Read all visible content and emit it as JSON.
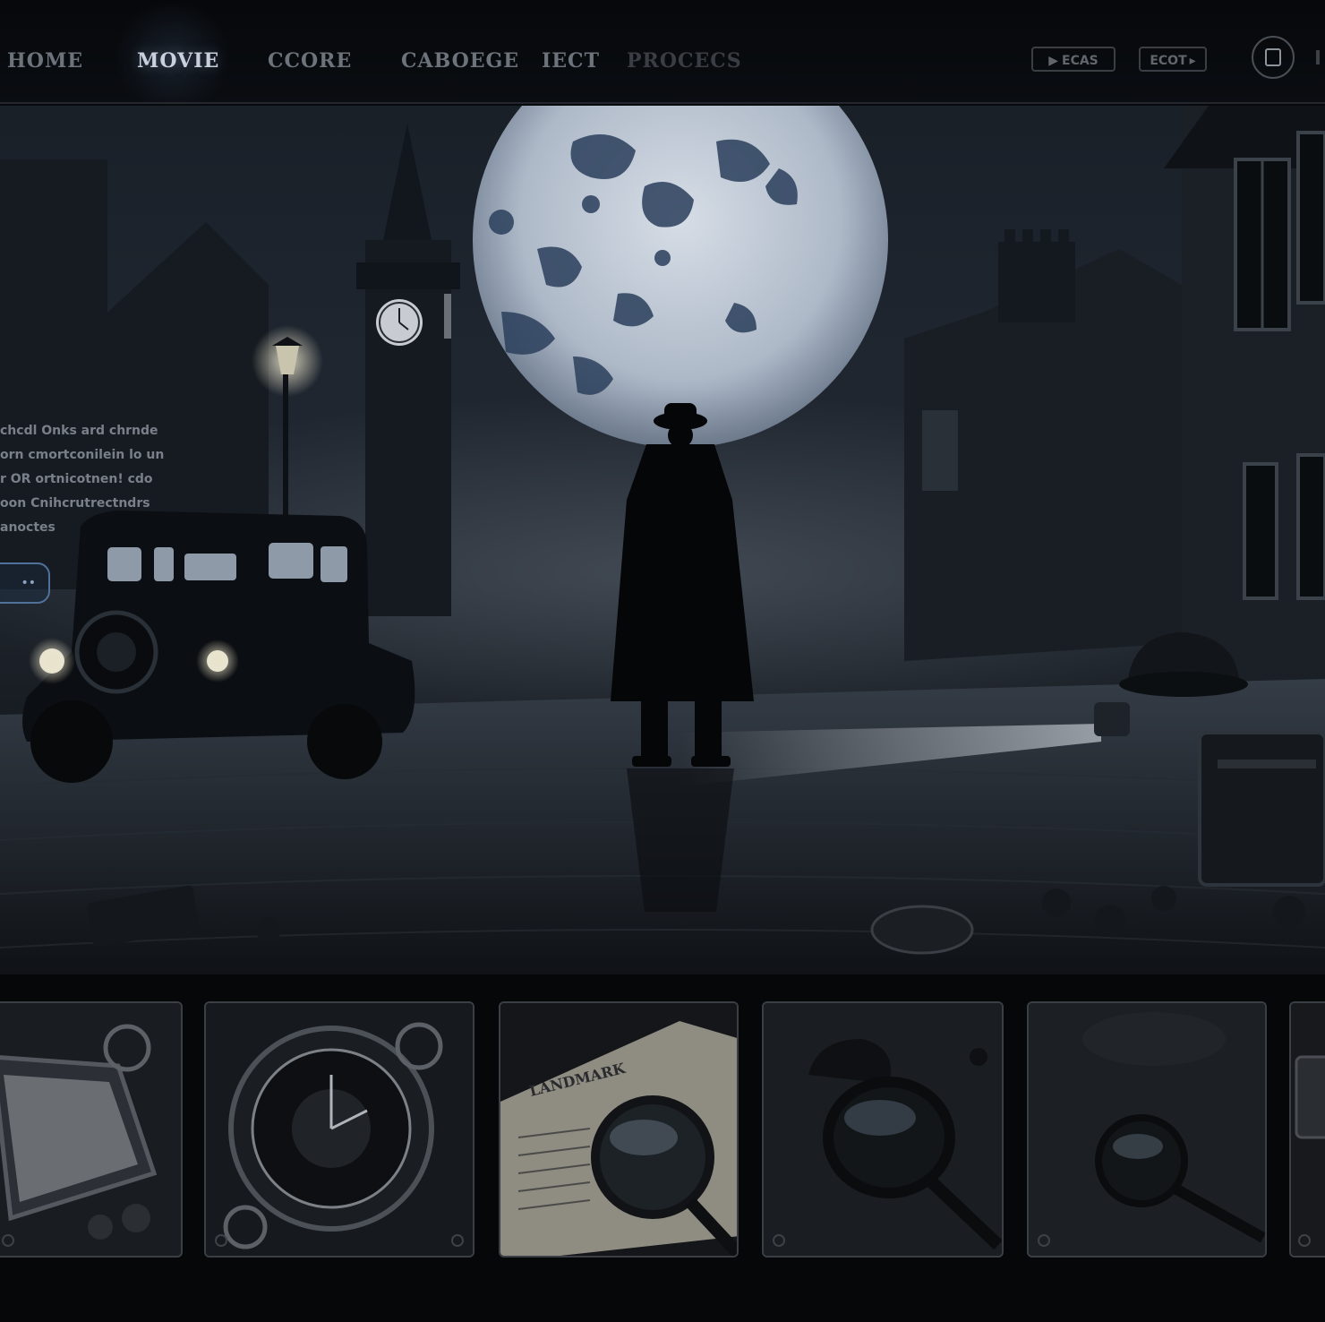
{
  "nav": {
    "items": [
      {
        "label": "HOME",
        "active": false
      },
      {
        "label": "MOVIE",
        "active": true
      },
      {
        "label": "CCORE",
        "active": false
      },
      {
        "label": "CABOEGE",
        "active": false
      },
      {
        "label": "IECT",
        "active": false
      },
      {
        "label": "PROCECS",
        "active": false
      }
    ],
    "chips": [
      {
        "label": "ECAS",
        "icon": "play-circle-icon"
      },
      {
        "label": "ECOT",
        "icon": "bookmark-icon"
      }
    ],
    "profile_icon": "account-square-icon"
  },
  "hero": {
    "description_lines": [
      "chcdl Onks ard chrnde",
      "orn cmortconilein lo un",
      "r OR  ortnicotnen! cdo",
      "oon Cnihcrutrectndrs",
      "anoctes"
    ],
    "cta_label": "••",
    "scene": "detective-night-scene"
  },
  "thumbnails": [
    {
      "subject": "framed-map-thumbnail"
    },
    {
      "subject": "pocket-watch-thumbnail"
    },
    {
      "subject": "newspaper-magnifier-thumbnail",
      "caption": "LANDMARK"
    },
    {
      "subject": "magnifier-hat-thumbnail"
    },
    {
      "subject": "magnifier-thumbnail"
    },
    {
      "subject": "partial-thumbnail"
    }
  ],
  "colors": {
    "background": "#07090c",
    "nav_active": "#c7d0dc",
    "nav_inactive": "#6d737b",
    "accent": "#50729a",
    "moon": "#c9d2de"
  }
}
